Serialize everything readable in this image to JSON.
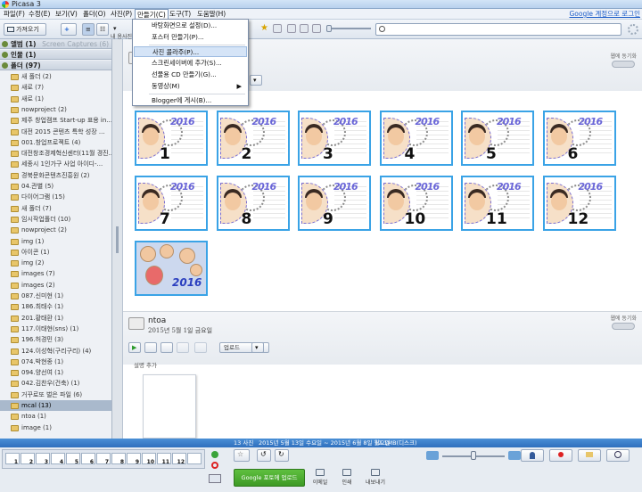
{
  "app": {
    "title": "Picasa 3"
  },
  "menubar": {
    "items": [
      {
        "label": "파일(F)"
      },
      {
        "label": "수정(E)"
      },
      {
        "label": "보기(V)"
      },
      {
        "label": "폴더(O)"
      },
      {
        "label": "사진(P)"
      },
      {
        "label": "만들기(C)"
      },
      {
        "label": "도구(T)"
      },
      {
        "label": "도움말(H)"
      }
    ],
    "google_link": "Google 계정으로 로그인"
  },
  "toolbar": {
    "import_label": "가져오기",
    "tab_label": "내 용사진"
  },
  "search": {
    "placeholder": ""
  },
  "create_menu": {
    "items": [
      {
        "label": "바탕화면으로 설정(D)..."
      },
      {
        "label": "포스터 만들기(P)..."
      },
      {
        "label": "사진 콜라주(P)..."
      },
      {
        "label": "스크린세이버에 추가(S)..."
      },
      {
        "label": "선물용 CD 만들기(G)..."
      },
      {
        "label": "동영상(M)",
        "submenu": "▶"
      },
      {
        "label": "Blogger에 게시(B)..."
      }
    ]
  },
  "sidebar": {
    "headers": [
      {
        "label": "앨범 (1)",
        "extra": "Screen Captures (6)"
      },
      {
        "label": "인물 (1)"
      },
      {
        "label": "폴더 (97)"
      }
    ],
    "items": [
      {
        "label": "새 폴더 (2)"
      },
      {
        "label": "새로 (7)"
      },
      {
        "label": "새로 (1)"
      },
      {
        "label": "nowproject (2)"
      },
      {
        "label": "제주 창업캠프 Start-up 표용 in..."
      },
      {
        "label": "대전 2015 콘텐츠 특학 성장 ..."
      },
      {
        "label": "001.창업프로젝트 (4)"
      },
      {
        "label": "대전창조경제혁신센터(11월 경진..."
      },
      {
        "label": "세종시 1인가구 사업 아이디-..."
      },
      {
        "label": "경북문화콘텐츠진흥원 (2)"
      },
      {
        "label": "04.관별 (5)"
      },
      {
        "label": "다이어그램 (15)"
      },
      {
        "label": "새 폴더 (7)"
      },
      {
        "label": "임시작업폴더 (10)"
      },
      {
        "label": "nowproject (2)"
      },
      {
        "label": "img (1)"
      },
      {
        "label": "아이콘 (1)"
      },
      {
        "label": "img (2)"
      },
      {
        "label": "images (7)"
      },
      {
        "label": "images (2)"
      },
      {
        "label": "087.신미현 (1)"
      },
      {
        "label": "186.최태수 (1)"
      },
      {
        "label": "201.황태환 (1)"
      },
      {
        "label": "117.이태현(sns) (1)"
      },
      {
        "label": "196.허경민 (3)"
      },
      {
        "label": "124.이성혁(구리구리) (4)"
      },
      {
        "label": "074.박현종 (1)"
      },
      {
        "label": "094.양선여 (1)"
      },
      {
        "label": "042.김찬우(건축) (1)"
      },
      {
        "label": "거꾸로또 벌은 파일 (6)"
      },
      {
        "label": "mcal (13)",
        "selected": true
      },
      {
        "label": "ntoa (1)"
      },
      {
        "label": "image (1)"
      }
    ]
  },
  "folder1": {
    "share_label": "웹에 동기화",
    "thumbnails": [
      {
        "num": "1",
        "year": "2016"
      },
      {
        "num": "2",
        "year": "2016"
      },
      {
        "num": "3",
        "year": "2016"
      },
      {
        "num": "4",
        "year": "2016"
      },
      {
        "num": "5",
        "year": "2016"
      },
      {
        "num": "6",
        "year": "2016"
      },
      {
        "num": "7",
        "year": "2016"
      },
      {
        "num": "8",
        "year": "2016"
      },
      {
        "num": "9",
        "year": "2016"
      },
      {
        "num": "10",
        "year": "2016"
      },
      {
        "num": "11",
        "year": "2016"
      },
      {
        "num": "12",
        "year": "2016"
      }
    ],
    "collage_year": "2016"
  },
  "folder2": {
    "name": "ntoa",
    "date": "2015년 5월 1일 금요일",
    "share_label": "웹에 동기화",
    "upload_label": "업로드",
    "caption_label": "설명 추가"
  },
  "status": {
    "count": "13 사진",
    "range": "2015년 5월 13일 수요일 ~ 2015년 6월 8일 월요일",
    "size": "12.1MB(디스크)"
  },
  "tray": {
    "thumbs": [
      "1",
      "2",
      "3",
      "4",
      "5",
      "6",
      "7",
      "8",
      "9",
      "10",
      "11",
      "12",
      ""
    ]
  },
  "bottom_actions": {
    "upload_google": "Google 포토에 업로드",
    "email": "이메일",
    "print": "인쇄",
    "export": "내보내기"
  }
}
